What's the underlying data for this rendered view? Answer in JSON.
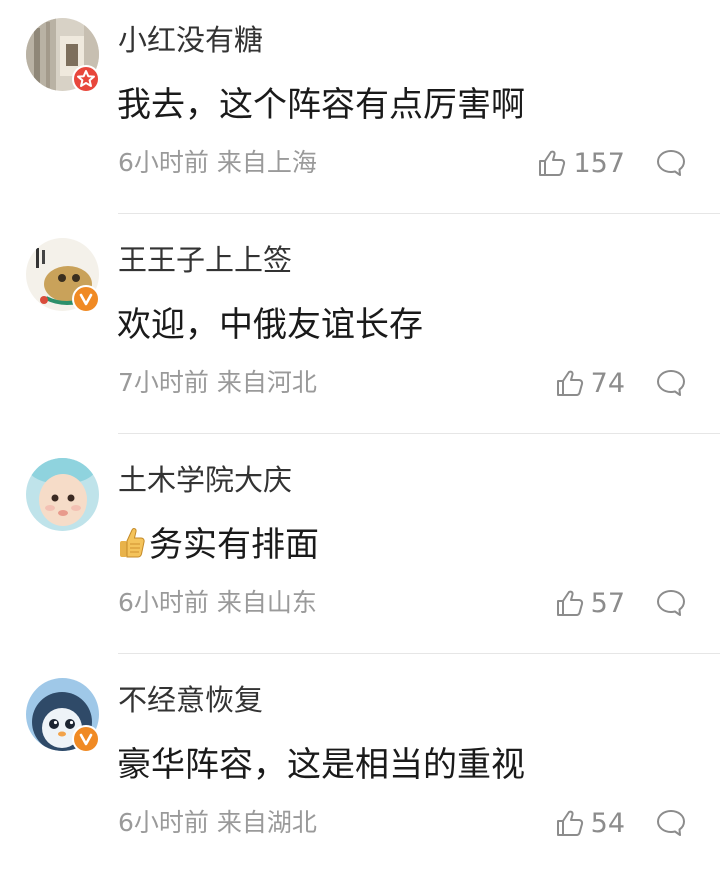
{
  "colors": {
    "verified_orange": "#f08a24",
    "star_red": "#e8473c"
  },
  "comments": [
    {
      "username": "小红没有糖",
      "text": "我去，这个阵容有点厉害啊",
      "time": "6小时前",
      "location": "来自上海",
      "likes": "157",
      "badge": "star-badge"
    },
    {
      "username": "王王子上上签",
      "text": "欢迎，中俄友谊长存",
      "time": "7小时前",
      "location": "来自河北",
      "likes": "74",
      "badge": "verified-badge"
    },
    {
      "username": "土木学院大庆",
      "text": "务实有排面",
      "emoji": "thumbs-up-emoji",
      "time": "6小时前",
      "location": "来自山东",
      "likes": "57",
      "badge": "none"
    },
    {
      "username": "不经意恢复",
      "text": "豪华阵容，这是相当的重视",
      "time": "6小时前",
      "location": "来自湖北",
      "likes": "54",
      "badge": "verified-badge"
    }
  ]
}
